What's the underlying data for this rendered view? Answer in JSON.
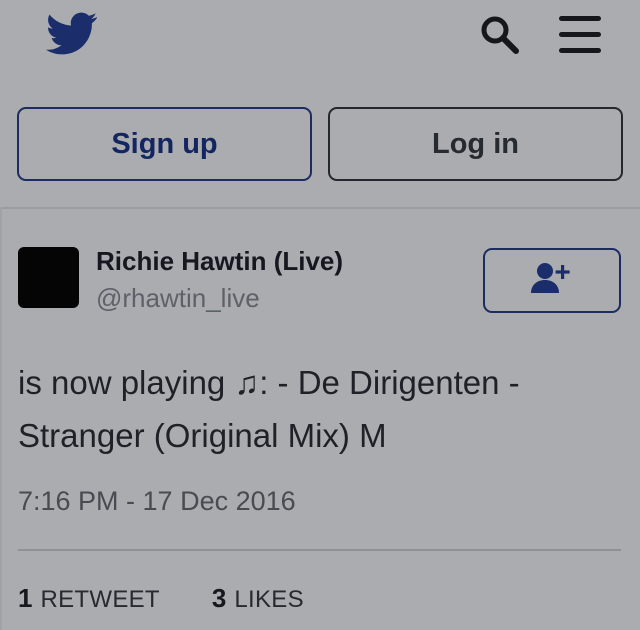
{
  "header": {
    "logo_icon": "twitter-bird-icon",
    "search_icon": "search-icon",
    "menu_icon": "hamburger-menu-icon",
    "brand_color": "#1b2e6b"
  },
  "auth": {
    "signup_label": "Sign up",
    "login_label": "Log in"
  },
  "tweet": {
    "author": {
      "name": "Richie Hawtin (Live)",
      "handle": "@rhawtin_live",
      "avatar_color": "#050505"
    },
    "follow_icon": "add-person-icon",
    "text": "is now playing ♫:  - De Dirigenten - Stranger (Original Mix) M",
    "timestamp": "7:16 PM - 17 Dec 2016",
    "stats": {
      "retweets_count": "1",
      "retweets_label": "RETWEET",
      "likes_count": "3",
      "likes_label": "LIKES"
    }
  }
}
